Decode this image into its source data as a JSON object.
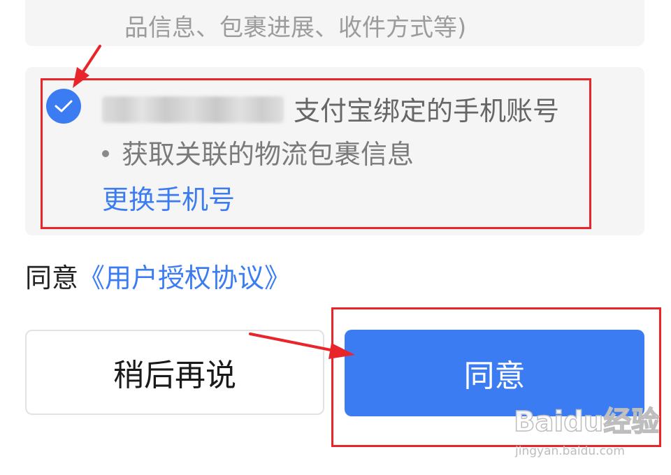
{
  "top_card": {
    "text": "品信息、包裹进展、收件方式等)"
  },
  "phone_card": {
    "checked": true,
    "phone_desc": "支付宝绑定的手机账号",
    "bullet": "获取关联的物流包裹信息",
    "change_link": "更换手机号"
  },
  "agreement": {
    "prefix": "同意",
    "link": "《用户授权协议》"
  },
  "buttons": {
    "later": "稍后再说",
    "agree": "同意"
  },
  "watermark": {
    "logo": "Baidu经验",
    "url": "jingyan.baidu.com"
  },
  "colors": {
    "accent": "#3c7cf3",
    "annotation_red": "#e8262a",
    "card_bg": "#f5f5f5"
  }
}
